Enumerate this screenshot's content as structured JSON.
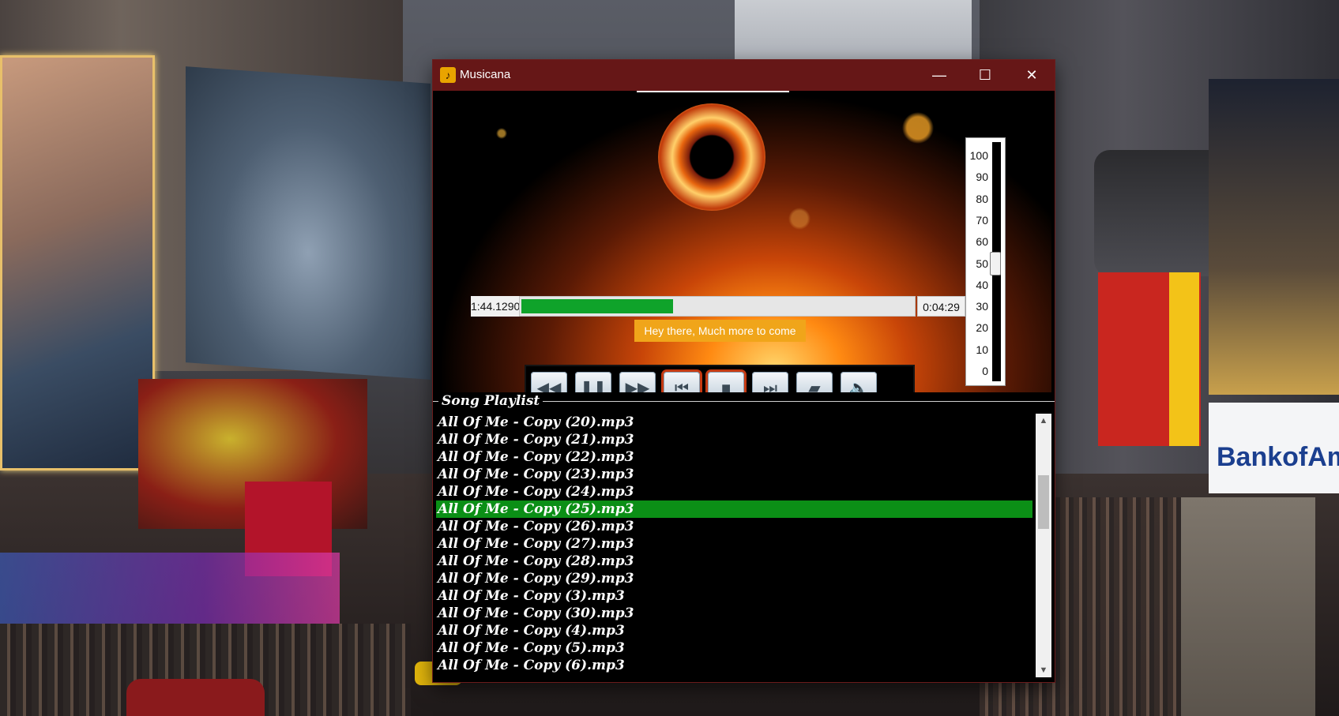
{
  "window": {
    "title": "Musicana",
    "icon": "music-note-icon",
    "controls": {
      "minimize": "—",
      "maximize": "☐",
      "close": "✕"
    }
  },
  "player": {
    "elapsed": "1:44.1290",
    "duration": "0:04:29",
    "progress_fraction": 0.387,
    "message": "Hey there, Much more to come",
    "buttons": [
      {
        "name": "rewind-button",
        "icon": "rewind-icon",
        "glyph": "◀◀"
      },
      {
        "name": "pause-button",
        "icon": "pause-icon",
        "glyph": "❚❚"
      },
      {
        "name": "fast-forward-button",
        "icon": "fast-forward-icon",
        "glyph": "▶▶"
      },
      {
        "name": "previous-button",
        "icon": "skip-previous-icon",
        "glyph": "⏮"
      },
      {
        "name": "stop-button",
        "icon": "stop-icon",
        "glyph": "■"
      },
      {
        "name": "next-button",
        "icon": "skip-next-icon",
        "glyph": "⏭"
      },
      {
        "name": "open-folder-button",
        "icon": "folder-icon",
        "glyph": "▰"
      },
      {
        "name": "volume-button",
        "icon": "speaker-icon",
        "glyph": "🔈"
      }
    ]
  },
  "volume": {
    "labels": [
      "100",
      "90",
      "80",
      "70",
      "60",
      "50",
      "40",
      "30",
      "20",
      "10",
      "0"
    ],
    "level": 50
  },
  "playlist": {
    "title": "Song Playlist",
    "selected_index": 5,
    "items": [
      "All Of Me - Copy (20).mp3",
      "All Of Me - Copy (21).mp3",
      "All Of Me - Copy (22).mp3",
      "All Of Me - Copy (23).mp3",
      "All Of Me - Copy (24).mp3",
      "All Of Me - Copy (25).mp3",
      "All Of Me - Copy (26).mp3",
      "All Of Me - Copy (27).mp3",
      "All Of Me - Copy (28).mp3",
      "All Of Me - Copy (29).mp3",
      "All Of Me - Copy (3).mp3",
      "All Of Me - Copy (30).mp3",
      "All Of Me - Copy (4).mp3",
      "All Of Me - Copy (5).mp3",
      "All Of Me - Copy (6).mp3"
    ]
  },
  "desktop": {
    "billboard_text": "BankofAmer"
  },
  "colors": {
    "titlebar": "#661717",
    "progress_fill": "#0fa32a",
    "selected_row": "#0b8f16",
    "message_bg": "#f0a51a"
  }
}
